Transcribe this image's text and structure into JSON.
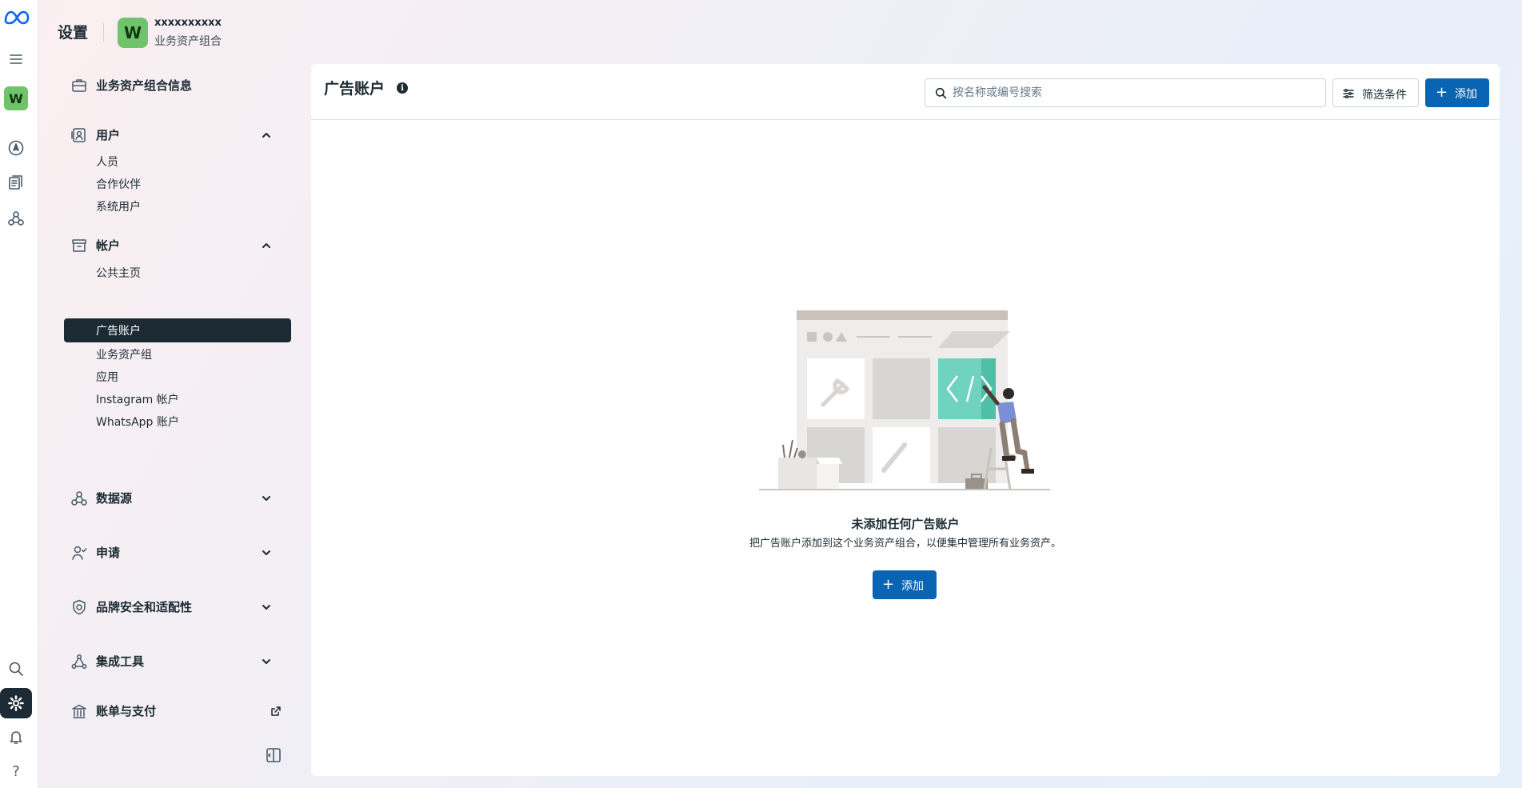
{
  "header": {
    "title": "设置",
    "account_avatar": "W",
    "account_name": "xxxxxxxxxx",
    "account_sub": "业务资产组合"
  },
  "rail": {
    "avatar": "W",
    "icons": [
      "meta-logo-icon",
      "menu-icon",
      "compass-icon",
      "pages-icon",
      "data-sources-icon",
      "search-icon",
      "settings-icon",
      "bell-icon",
      "help-icon"
    ]
  },
  "sidebar": {
    "business_info": "业务资产组合信息",
    "users": {
      "label": "用户",
      "items": [
        "人员",
        "合作伙伴",
        "系统用户"
      ]
    },
    "accounts": {
      "label": "帐户",
      "items": [
        "公共主页",
        "广告账户",
        "业务资产组",
        "应用",
        "Instagram 帐户",
        "WhatsApp 账户"
      ],
      "active": "广告账户"
    },
    "data_sources": "数据源",
    "requests": "申请",
    "brand_safety": "品牌安全和适配性",
    "integrations": "集成工具",
    "billing": "账单与支付"
  },
  "main": {
    "title": "广告账户",
    "search_placeholder": "按名称或编号搜索",
    "filter_label": "筛选条件",
    "add_label": "添加",
    "empty_title": "未添加任何广告账户",
    "empty_desc": "把广告账户添加到这个业务资产组合，以便集中管理所有业务资产。",
    "empty_add_label": "添加"
  },
  "colors": {
    "primary": "#0a64b4",
    "dark": "#1c2b33",
    "avatar_green": "#6fc46b",
    "illustration_teal": "#6fd3bf"
  }
}
